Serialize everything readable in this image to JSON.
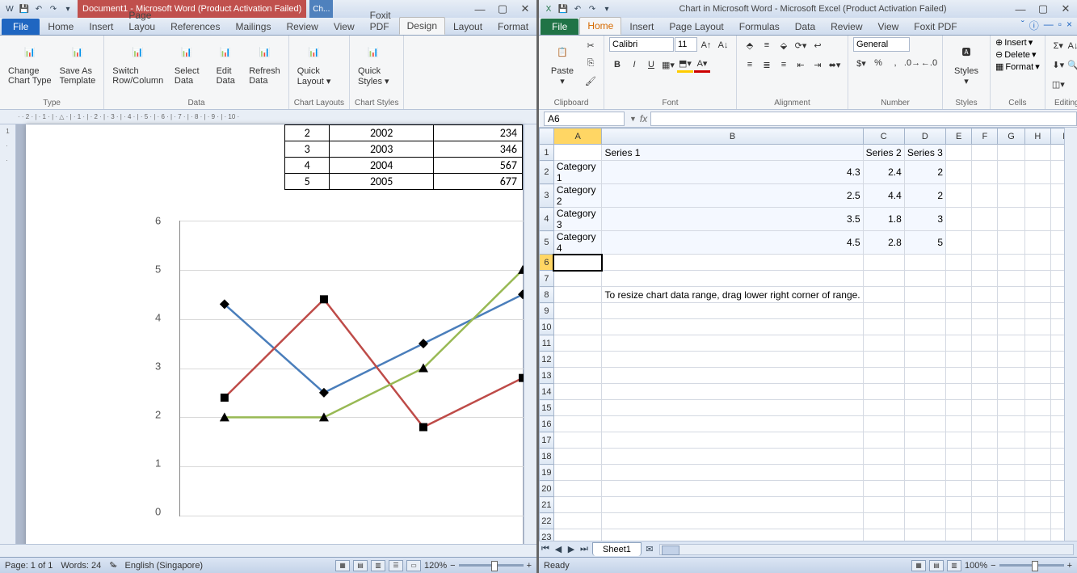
{
  "word": {
    "title": "Document1 - Microsoft Word (Product Activation Failed)",
    "contextual_tab": "Ch...",
    "tabs": [
      "Home",
      "Insert",
      "Page Layou",
      "References",
      "Mailings",
      "Review",
      "View",
      "Foxit PDF"
    ],
    "ctx_tabs": [
      "Design",
      "Layout",
      "Format"
    ],
    "ribbon_groups": {
      "type": {
        "label": "Type",
        "buttons": [
          {
            "name": "change-chart-type",
            "lbl": "Change\nChart Type"
          },
          {
            "name": "save-as-template",
            "lbl": "Save As\nTemplate"
          }
        ]
      },
      "data": {
        "label": "Data",
        "buttons": [
          {
            "name": "switch-row-col",
            "lbl": "Switch\nRow/Column"
          },
          {
            "name": "select-data",
            "lbl": "Select\nData"
          },
          {
            "name": "edit-data",
            "lbl": "Edit\nData"
          },
          {
            "name": "refresh-data",
            "lbl": "Refresh\nData"
          }
        ]
      },
      "layouts": {
        "label": "Chart Layouts",
        "buttons": [
          {
            "name": "quick-layout",
            "lbl": "Quick\nLayout ▾"
          }
        ]
      },
      "styles": {
        "label": "Chart Styles",
        "buttons": [
          {
            "name": "quick-styles",
            "lbl": "Quick\nStyles ▾"
          }
        ]
      }
    },
    "ruler_h": "· · 2 · | · 1 · | · △ · | · 1 · | · 2 · | · 3 · | · 4 · | · 5 · | · 6 · | · 7 · | · 8 · | · 9 · | · 10 ·",
    "doc_table": [
      [
        "2",
        "2002",
        "234"
      ],
      [
        "3",
        "2003",
        "346"
      ],
      [
        "4",
        "2004",
        "567"
      ],
      [
        "5",
        "2005",
        "677"
      ]
    ],
    "status": {
      "page": "Page: 1 of 1",
      "words": "Words: 24",
      "lang": "English (Singapore)",
      "zoom": "120%"
    }
  },
  "excel": {
    "title": "Chart in Microsoft Word - Microsoft Excel (Product Activation Failed)",
    "tabs": [
      "Home",
      "Insert",
      "Page Layout",
      "Formulas",
      "Data",
      "Review",
      "View",
      "Foxit PDF"
    ],
    "ribbon": {
      "clipboard": "Clipboard",
      "paste": "Paste",
      "font": "Font",
      "font_name": "Calibri",
      "font_size": "11",
      "alignment": "Alignment",
      "number": "Number",
      "number_fmt": "General",
      "styles": "Styles",
      "cells": "Cells",
      "insert": "Insert",
      "delete": "Delete",
      "format": "Format",
      "editing": "Editing"
    },
    "namebox": "A6",
    "fx": "fx",
    "cols": [
      "A",
      "B",
      "C",
      "D",
      "E",
      "F",
      "G",
      "H",
      "I"
    ],
    "rows": 25,
    "data": {
      "B1": "Series 1",
      "C1": "Series 2",
      "D1": "Series 3",
      "A2": "Category 1",
      "B2": "4.3",
      "C2": "2.4",
      "D2": "2",
      "A3": "Category 2",
      "B3": "2.5",
      "C3": "4.4",
      "D3": "2",
      "A4": "Category 3",
      "B4": "3.5",
      "C4": "1.8",
      "D4": "3",
      "A5": "Category 4",
      "B5": "4.5",
      "C5": "2.8",
      "D5": "5"
    },
    "tip": "To resize chart data range, drag lower right corner of range.",
    "sheet_name": "Sheet1",
    "status": "Ready",
    "zoom": "100%"
  },
  "chart_data": {
    "type": "line",
    "categories": [
      "Category 1",
      "Category 2",
      "Category 3",
      "Category 4"
    ],
    "series": [
      {
        "name": "Series 1",
        "values": [
          4.3,
          2.5,
          3.5,
          4.5
        ],
        "color": "#4a7ebb",
        "marker": "diamond"
      },
      {
        "name": "Series 2",
        "values": [
          2.4,
          4.4,
          1.8,
          2.8
        ],
        "color": "#be4b48",
        "marker": "square"
      },
      {
        "name": "Series 3",
        "values": [
          2,
          2,
          3,
          5
        ],
        "color": "#98b954",
        "marker": "triangle"
      }
    ],
    "ylim": [
      0,
      6
    ],
    "yticks": [
      0,
      1,
      2,
      3,
      4,
      5,
      6
    ]
  }
}
